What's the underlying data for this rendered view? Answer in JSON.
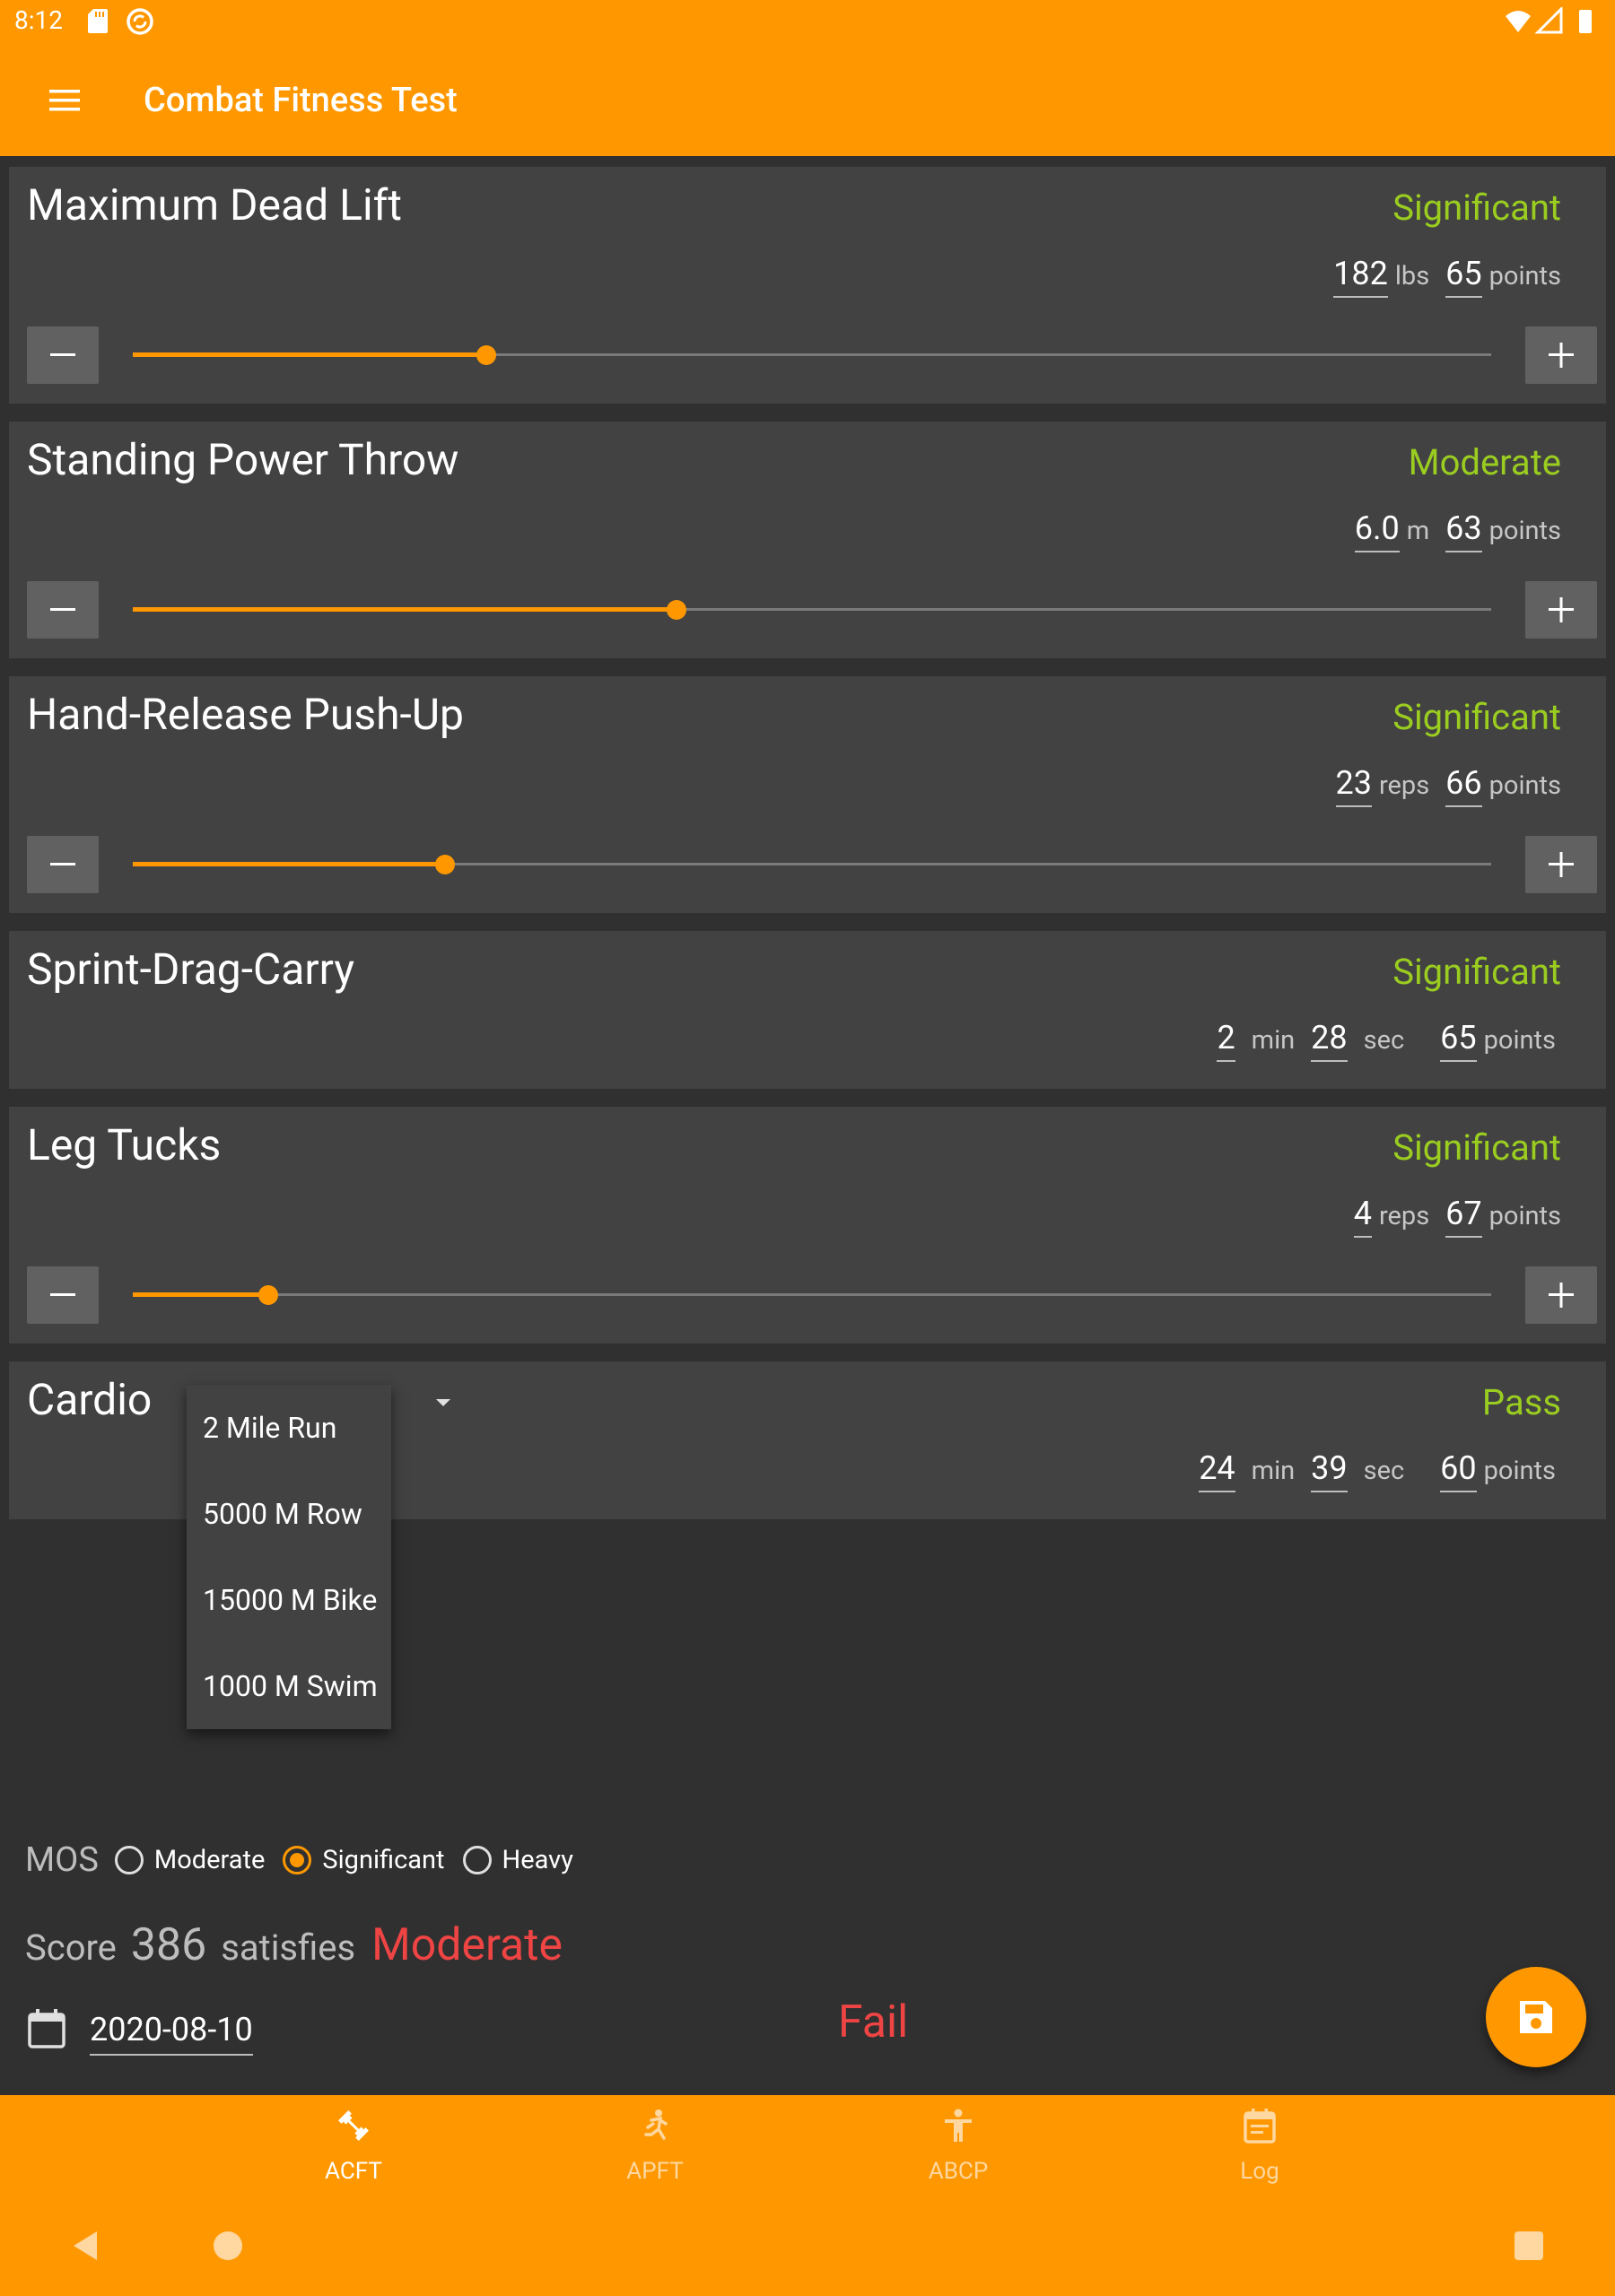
{
  "status_bar": {
    "time": "8:12"
  },
  "app_bar": {
    "title": "Combat Fitness Test",
    "menu_icon": "menu-icon"
  },
  "events": [
    {
      "title": "Maximum Dead Lift",
      "status": "Significant",
      "value": "182",
      "unit": "lbs",
      "points": "65",
      "points_label": "points",
      "slider_fraction": 0.26
    },
    {
      "title": "Standing Power Throw",
      "status": "Moderate",
      "value": "6.0",
      "unit": "m",
      "points": "63",
      "points_label": "points",
      "slider_fraction": 0.4
    },
    {
      "title": "Hand-Release Push-Up",
      "status": "Significant",
      "value": "23",
      "unit": "reps",
      "points": "66",
      "points_label": "points",
      "slider_fraction": 0.23
    },
    {
      "title": "Sprint-Drag-Carry",
      "status": "Significant",
      "minutes": "2",
      "min_label": "min",
      "seconds": "28",
      "sec_label": "sec",
      "points": "65",
      "points_label": "points"
    },
    {
      "title": "Leg Tucks",
      "status": "Significant",
      "value": "4",
      "unit": "reps",
      "points": "67",
      "points_label": "points",
      "slider_fraction": 0.1
    },
    {
      "title": "Cardio",
      "status": "Pass",
      "minutes": "24",
      "min_label": "min",
      "seconds": "39",
      "sec_label": "sec",
      "points": "60",
      "points_label": "points"
    }
  ],
  "cardio_options": [
    "2 Mile Run",
    "5000 M Row",
    "15000 M Bike",
    "1000 M Swim"
  ],
  "mos": {
    "label": "MOS",
    "options": [
      "Moderate",
      "Significant",
      "Heavy"
    ],
    "selected": "Significant"
  },
  "score": {
    "prefix": "Score",
    "value": "386",
    "middle": "satisfies",
    "result": "Moderate"
  },
  "date": "2020-08-10",
  "overall_result": "Fail",
  "bottom_nav": [
    {
      "label": "ACFT",
      "icon": "dumbbell-icon",
      "active": true
    },
    {
      "label": "APFT",
      "icon": "running-icon",
      "active": false
    },
    {
      "label": "ABCP",
      "icon": "person-icon",
      "active": false
    },
    {
      "label": "Log",
      "icon": "calendar-log-icon",
      "active": false
    }
  ],
  "colors": {
    "accent": "#ff9800",
    "background": "#303030",
    "card": "#424242",
    "status_good": "#9acd20",
    "status_bad": "#ef4444"
  }
}
